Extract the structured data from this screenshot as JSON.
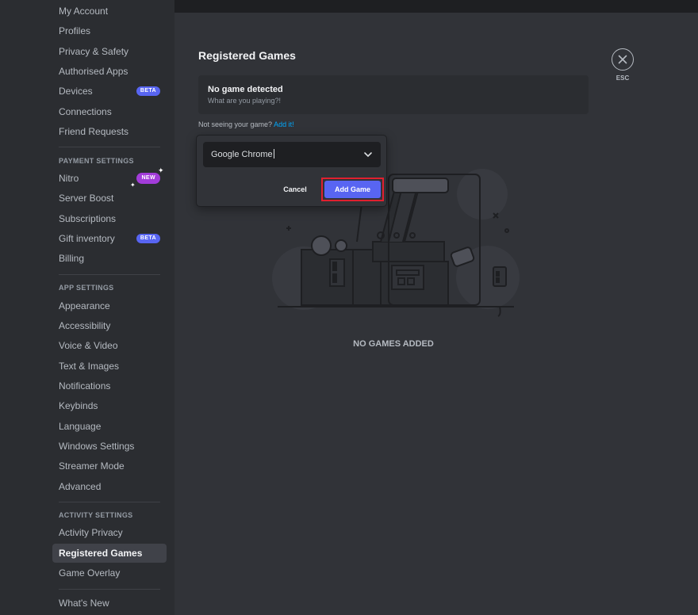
{
  "sidebar": {
    "top_items": [
      {
        "label": "My Account"
      },
      {
        "label": "Profiles"
      },
      {
        "label": "Privacy & Safety"
      },
      {
        "label": "Authorised Apps"
      },
      {
        "label": "Devices",
        "badge": "BETA"
      },
      {
        "label": "Connections"
      },
      {
        "label": "Friend Requests"
      }
    ],
    "payment_heading": "PAYMENT SETTINGS",
    "payment_items": [
      {
        "label": "Nitro",
        "badge": "NEW"
      },
      {
        "label": "Server Boost"
      },
      {
        "label": "Subscriptions"
      },
      {
        "label": "Gift inventory",
        "badge": "BETA"
      },
      {
        "label": "Billing"
      }
    ],
    "app_heading": "APP SETTINGS",
    "app_items": [
      {
        "label": "Appearance"
      },
      {
        "label": "Accessibility"
      },
      {
        "label": "Voice & Video"
      },
      {
        "label": "Text & Images"
      },
      {
        "label": "Notifications"
      },
      {
        "label": "Keybinds"
      },
      {
        "label": "Language"
      },
      {
        "label": "Windows Settings"
      },
      {
        "label": "Streamer Mode"
      },
      {
        "label": "Advanced"
      }
    ],
    "activity_heading": "ACTIVITY SETTINGS",
    "activity_items": [
      {
        "label": "Activity Privacy"
      },
      {
        "label": "Registered Games",
        "active": true
      },
      {
        "label": "Game Overlay"
      }
    ],
    "bottom_items": [
      {
        "label": "What's New"
      }
    ]
  },
  "main": {
    "title": "Registered Games",
    "detect_title": "No game detected",
    "detect_sub": "What are you playing?!",
    "not_seeing_text": "Not seeing your game?",
    "add_it_link": "Add it!",
    "empty_text": "NO GAMES ADDED"
  },
  "popup": {
    "select_value": "Google Chrome",
    "cancel_label": "Cancel",
    "add_label": "Add Game"
  },
  "close": {
    "esc_label": "ESC",
    "icon": "close-icon"
  },
  "colors": {
    "accent": "#5865f2",
    "highlight": "#e0202f",
    "link": "#00a8fc",
    "new_badge": "#a23cd9"
  }
}
